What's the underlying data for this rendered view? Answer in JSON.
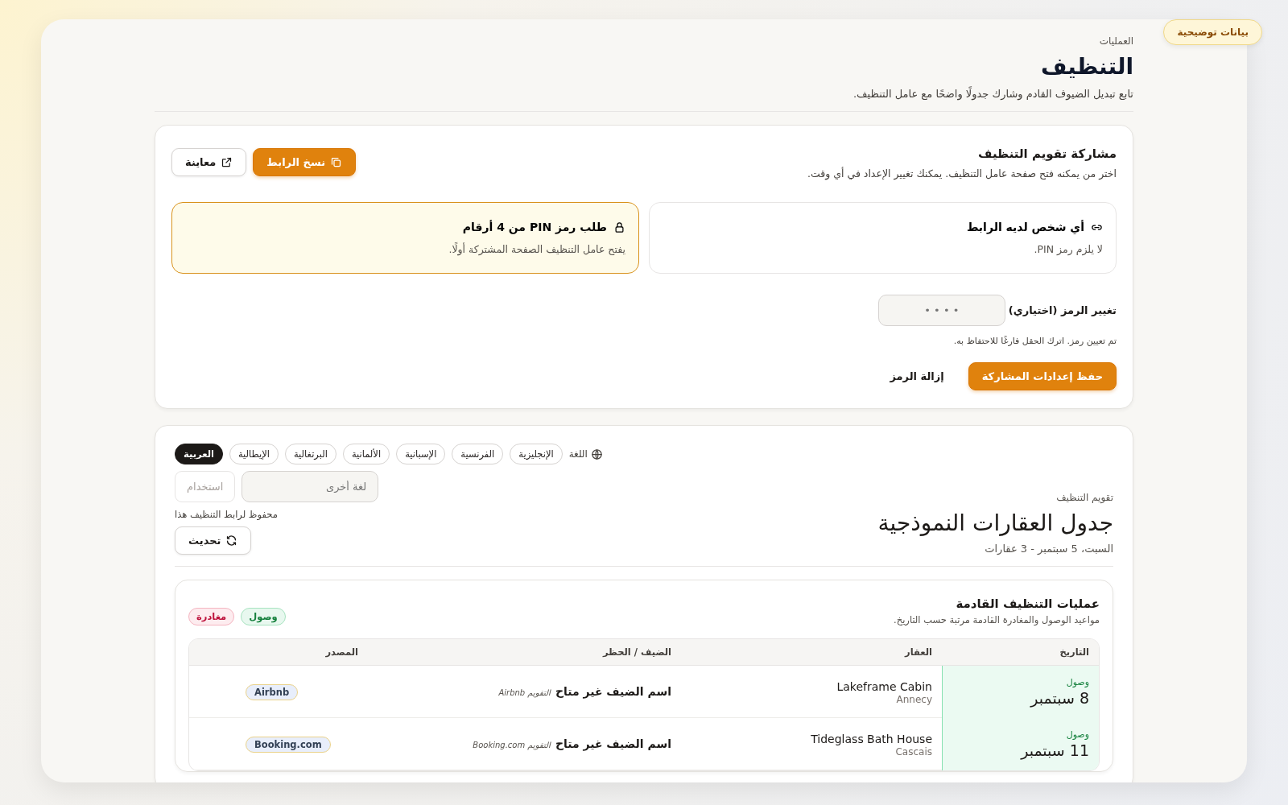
{
  "demo_badge": "بيانات توضيحية",
  "header": {
    "breadcrumb": "العمليات",
    "title": "التنظيف",
    "subtitle": "تابع تبديل الضيوف القادم وشارك جدولًا واضحًا مع عامل التنظيف."
  },
  "share": {
    "title": "مشاركة تقويم التنظيف",
    "description": "اختر من يمكنه فتح صفحة عامل التنظيف. يمكنك تغيير الإعداد في أي وقت.",
    "copy_button": "نسخ الرابط",
    "preview_button": "معاينة",
    "options": [
      {
        "kind": "link",
        "title": "أي شخص لديه الرابط",
        "description": "لا يلزم رمز PIN.",
        "selected": false
      },
      {
        "kind": "pin",
        "title": "طلب رمز PIN من 4 أرقام",
        "description": "يفتح عامل التنظيف الصفحة المشتركة أولًا.",
        "selected": true
      }
    ],
    "pin_label": "تغيير الرمز (اختياري)",
    "pin_placeholder": "• • • •",
    "pin_hint": "تم تعيين رمز. اترك الحقل فارغًا للاحتفاظ به.",
    "save_button": "حفظ إعدادات المشاركة",
    "remove_button": "إزالة الرمز"
  },
  "calendar": {
    "eyebrow": "تقويم التنظيف",
    "title": "جدول العقارات النموذجية",
    "meta": "السبت، 5 سبتمبر - 3 عقارات",
    "language_label": "اللغة",
    "languages": [
      {
        "label": "الإنجليزية",
        "selected": false
      },
      {
        "label": "الفرنسية",
        "selected": false
      },
      {
        "label": "الإسبانية",
        "selected": false
      },
      {
        "label": "الألمانية",
        "selected": false
      },
      {
        "label": "البرتغالية",
        "selected": false
      },
      {
        "label": "الإيطالية",
        "selected": false
      },
      {
        "label": "العربية",
        "selected": true
      }
    ],
    "other_language_placeholder": "لغة أخرى",
    "use_button": "استخدام",
    "saved_note": "محفوظ لرابط التنظيف هذا",
    "refresh_button": "تحديث"
  },
  "upcoming": {
    "title": "عمليات التنظيف القادمة",
    "subtitle": "مواعيد الوصول والمغادرة القادمة مرتبة حسب التاريخ.",
    "legend": [
      {
        "kind": "arrival",
        "label": "وصول"
      },
      {
        "kind": "departure",
        "label": "مغادرة"
      }
    ],
    "columns": [
      "التاريخ",
      "العقار",
      "الضيف / الحظر",
      "المصدر"
    ],
    "rows": [
      {
        "kind": "arrival",
        "type_label": "وصول",
        "date": "8 سبتمبر",
        "property": "Lakeframe Cabin",
        "city": "Annecy",
        "guest": "اسم الضيف غير متاح",
        "guest_meta": "التقويم Airbnb",
        "source": "Airbnb"
      },
      {
        "kind": "arrival",
        "type_label": "وصول",
        "date": "11 سبتمبر",
        "property": "Tideglass Bath House",
        "city": "Cascais",
        "guest": "اسم الضيف غير متاح",
        "guest_meta": "التقويم Booking.com",
        "source": "Booking.com"
      }
    ]
  }
}
